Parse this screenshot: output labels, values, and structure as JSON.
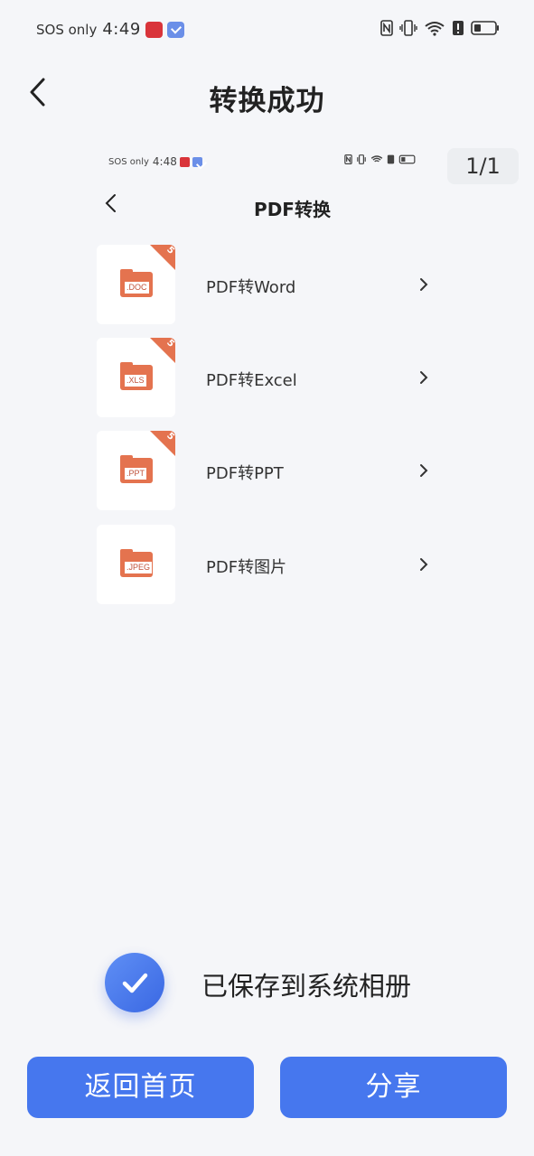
{
  "status_bar": {
    "carrier": "SOS only",
    "time": "4:49"
  },
  "header": {
    "title": "转换成功",
    "page_counter": "1/1"
  },
  "preview": {
    "status_bar": {
      "carrier": "SOS only",
      "time": "4:48"
    },
    "title": "PDF转换",
    "items": [
      {
        "label": "PDF转Word",
        "file_ext": ".DOC",
        "badge": "5",
        "icon": "doc-file-icon"
      },
      {
        "label": "PDF转Excel",
        "file_ext": ".XLS",
        "badge": "5",
        "icon": "xls-file-icon"
      },
      {
        "label": "PDF转PPT",
        "file_ext": ".PPT",
        "badge": "5",
        "icon": "ppt-file-icon"
      },
      {
        "label": "PDF转图片",
        "file_ext": ".JPEG",
        "badge": "",
        "icon": "jpeg-file-icon"
      }
    ]
  },
  "saved_message": "已保存到系统相册",
  "buttons": {
    "home": "返回首页",
    "share": "分享"
  },
  "colors": {
    "accent": "#4677ee",
    "file_icon": "#e4734f",
    "background": "#f5f6f9"
  }
}
